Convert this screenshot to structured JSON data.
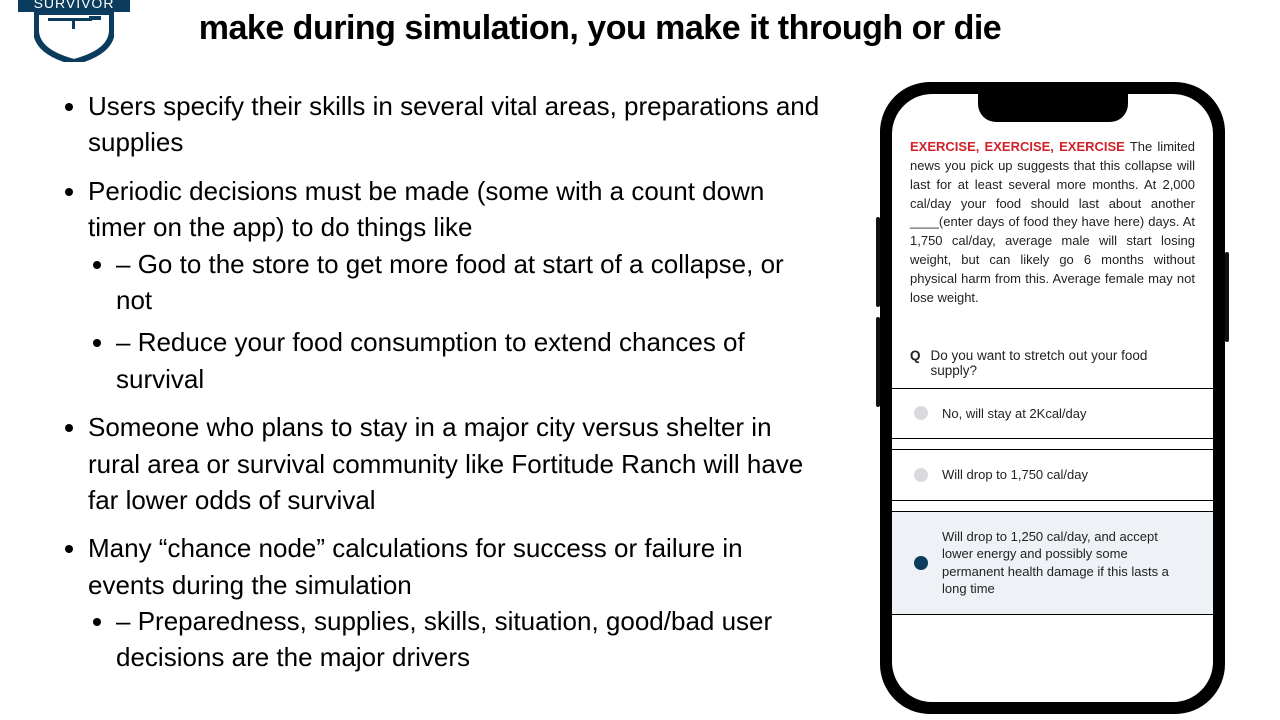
{
  "logo": {
    "text": "SURVIVOR"
  },
  "headline": "make during simulation, you make it through or die",
  "bullets": [
    {
      "text": "Users specify their skills in several vital areas, preparations and supplies",
      "sub": []
    },
    {
      "text": "Periodic decisions must be made (some with a count down timer on the app) to do things like",
      "sub": [
        "Go to the store to get more food at start of a collapse, or not",
        "Reduce your food consumption to extend chances of survival"
      ]
    },
    {
      "text": "Someone who plans to stay in a major city versus shelter in rural area or survival community like Fortitude Ranch will have far lower odds of survival",
      "sub": []
    },
    {
      "text": "Many “chance node” calculations for success or failure in events during the simulation",
      "sub": [
        "Preparedness, supplies, skills, situation, good/bad user decisions are the major drivers"
      ]
    }
  ],
  "phone": {
    "exercise_label": "EXERCISE, EXERCISE, EXERCISE",
    "exercise_body": " The limited news you pick up suggests that this collapse will last for at least several more months. At 2,000 cal/day your food should last about another ____(enter days of food they have here) days. At 1,750 cal/day, average male will start losing weight, but can likely go 6 months without physical harm from this. Average female may not lose weight.",
    "question_marker": "Q",
    "question": "Do you want to stretch out your food supply?",
    "options": [
      {
        "label": "No, will stay at 2Kcal/day",
        "selected": false
      },
      {
        "label": "Will drop to 1,750 cal/day",
        "selected": false
      },
      {
        "label": "Will drop to 1,250 cal/day, and accept lower energy and possibly some permanent health damage if this lasts a long time",
        "selected": true
      }
    ]
  }
}
